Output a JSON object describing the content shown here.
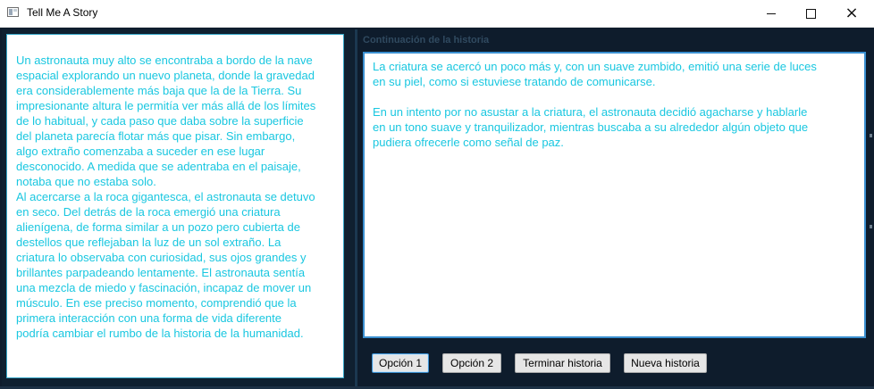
{
  "window": {
    "title": "Tell Me A Story",
    "icon": "app-window-icon",
    "controls": {
      "minimize": "minimize-icon",
      "maximize": "maximize-icon",
      "close": "×"
    }
  },
  "story": {
    "text": "Un astronauta muy alto se encontraba a bordo de la nave\nespacial explorando un nuevo planeta, donde la gravedad\nera considerablemente más baja que la de la Tierra. Su\nimpresionante altura le permitía ver más allá de los límites\nde lo habitual, y cada paso que daba sobre la superficie\ndel planeta parecía flotar más que pisar. Sin embargo,\nalgo extraño comenzaba a suceder en ese lugar\ndesconocido. A medida que se adentraba en el paisaje,\nnotaba que no estaba solo.\nAl acercarse a la roca gigantesca, el astronauta se detuvo\nen seco. Del detrás de la roca emergió una criatura\nalienígena, de forma similar a un pozo pero cubierta de\ndestellos que reflejaban la luz de un sol extraño. La\ncriatura lo observaba con curiosidad, sus ojos grandes y\nbrillantes parpadeando lentamente. El astronauta sentía\nuna mezcla de miedo y fascinación, incapaz de mover un\nmúsculo. En ese preciso momento, comprendió que la\nprimera interacción con una forma de vida diferente\npodría cambiar el rumbo de la historia de la humanidad."
  },
  "continuation": {
    "label": "Continuación de la historia",
    "text": "La criatura se acercó un poco más y, con un suave zumbido, emitió una serie de luces\nen su piel, como si estuviese tratando de comunicarse.\n\nEn un intento por no asustar a la criatura, el astronauta decidió agacharse y hablarle\nen un tono suave y tranquilizador, mientras buscaba a su alrededor algún objeto que\npudiera ofrecerle como señal de paz."
  },
  "buttons": {
    "option1": "Opción 1",
    "option2": "Opción 2",
    "end_story": "Terminar historia",
    "new_story": "Nueva historia"
  },
  "colors": {
    "story_text": "#19c7e0",
    "background": "#0e1c2c",
    "accent_border": "#3a8fd0"
  }
}
